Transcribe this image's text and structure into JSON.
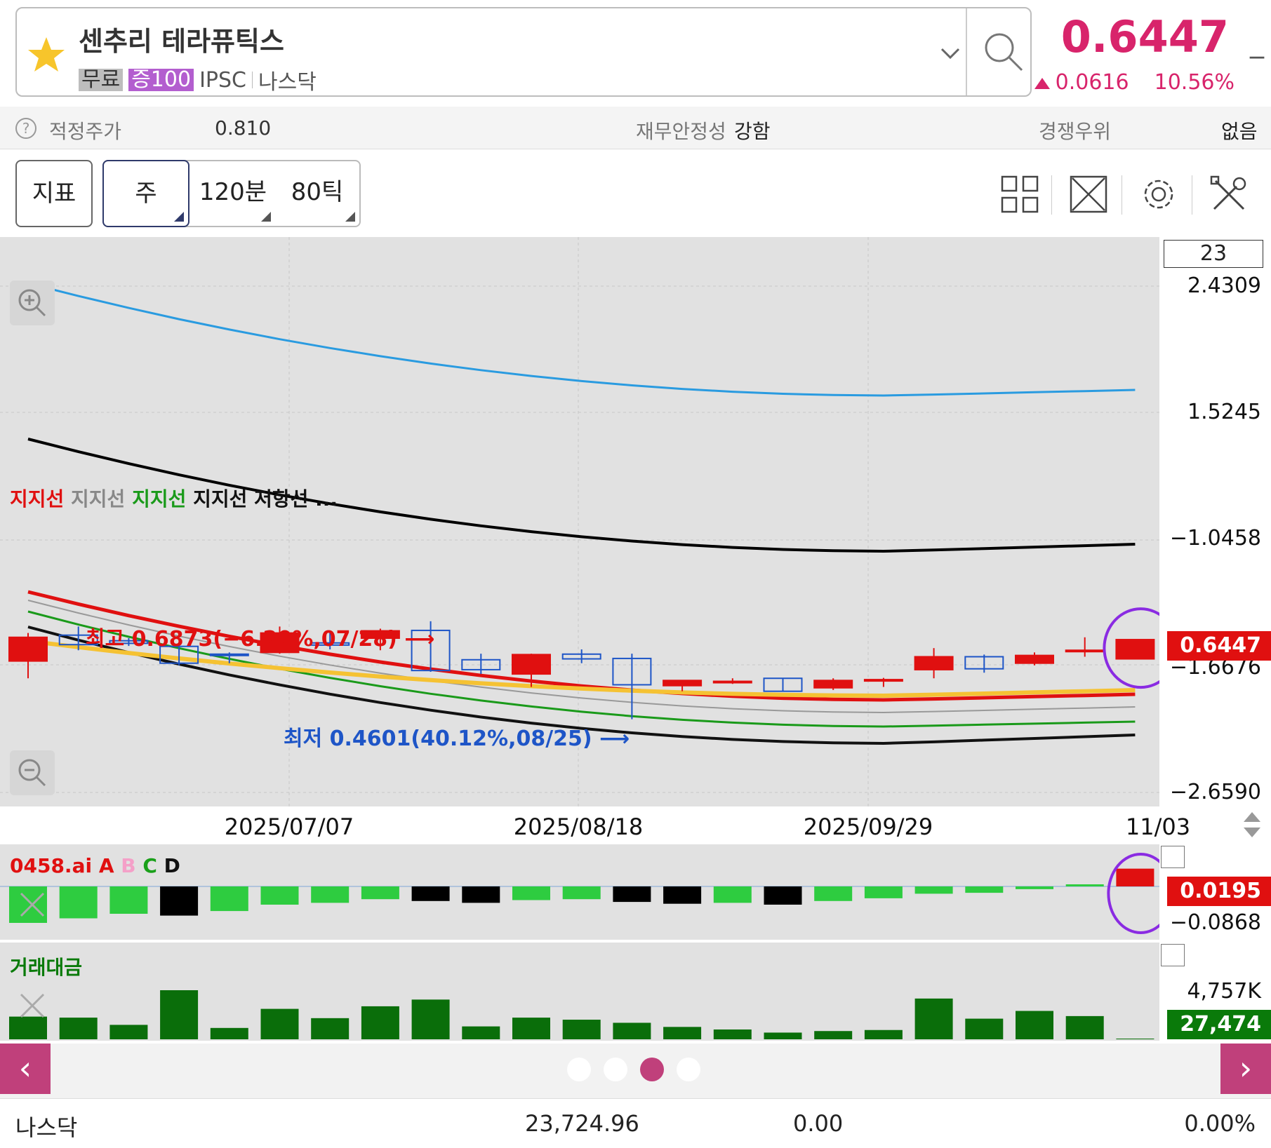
{
  "header": {
    "stock_name": "센추리 테라퓨틱스",
    "tags": {
      "free": "무료",
      "margin": "증100",
      "ticker": "IPSC",
      "exchange": "나스닥"
    },
    "price": "0.6447",
    "dash": "_",
    "change": "0.0616",
    "change_pct": "10.56%"
  },
  "fundamentals": {
    "fair_price_label": "적정주가",
    "fair_price_value": "0.810",
    "stability_label": "재무안정성",
    "stability_value": "강함",
    "competitive_label": "경쟁우위",
    "competitive_value": "없음"
  },
  "toolbar": {
    "indicator": "지표",
    "week": "주",
    "min120": "120분",
    "tick80": "80틱"
  },
  "main_chart": {
    "legend": [
      {
        "text": "지지선",
        "color": "#e01010"
      },
      {
        "text": "지지선",
        "color": "#888888"
      },
      {
        "text": "지지선",
        "color": "#1a9a1a"
      },
      {
        "text": "지지선",
        "color": "#111111"
      },
      {
        "text": "저항선 ...",
        "color": "#111111"
      }
    ],
    "zoom_box": "23",
    "y_labels": [
      "2.4309",
      "1.5245",
      "−1.0458",
      "−1.6676",
      "−2.6590"
    ],
    "price_pill": "0.6447",
    "high_annotation": "최고 0.6873(−6.20%,07/28)",
    "low_annotation": "최저 0.4601(40.12%,08/25)",
    "dates": [
      "2025/07/07",
      "2025/08/18",
      "2025/09/29",
      "11/03"
    ]
  },
  "ai_panel": {
    "title": "0458.ai",
    "letters": [
      {
        "text": "A",
        "color": "#e01010"
      },
      {
        "text": "B",
        "color": "#f4a0c8"
      },
      {
        "text": "C",
        "color": "#1aa01a"
      },
      {
        "text": "D",
        "color": "#111111"
      }
    ],
    "pill": "0.0195",
    "y_label": "−0.0868"
  },
  "volume_panel": {
    "title": "거래대금",
    "y_label": "4,757K",
    "pill": "27,474"
  },
  "chart_data": {
    "type": "candlestick",
    "candles": [
      {
        "o": 0.595,
        "h": 0.66,
        "l": 0.555,
        "c": 0.65,
        "up": true
      },
      {
        "o": 0.655,
        "h": 0.675,
        "l": 0.62,
        "c": 0.633,
        "up": false
      },
      {
        "o": 0.636,
        "h": 0.648,
        "l": 0.63,
        "c": 0.642,
        "up": false
      },
      {
        "o": 0.629,
        "h": 0.637,
        "l": 0.585,
        "c": 0.59,
        "up": false
      },
      {
        "o": 0.611,
        "h": 0.615,
        "l": 0.59,
        "c": 0.611,
        "up": false
      },
      {
        "o": 0.615,
        "h": 0.675,
        "l": 0.612,
        "c": 0.66,
        "up": true
      },
      {
        "o": 0.637,
        "h": 0.66,
        "l": 0.622,
        "c": 0.632,
        "up": false
      },
      {
        "o": 0.648,
        "h": 0.67,
        "l": 0.62,
        "c": 0.665,
        "up": true
      },
      {
        "o": 0.666,
        "h": 0.6873,
        "l": 0.57,
        "c": 0.573,
        "up": false
      },
      {
        "o": 0.598,
        "h": 0.612,
        "l": 0.565,
        "c": 0.575,
        "up": false
      },
      {
        "o": 0.565,
        "h": 0.612,
        "l": 0.535,
        "c": 0.61,
        "up": true
      },
      {
        "o": 0.611,
        "h": 0.622,
        "l": 0.59,
        "c": 0.6,
        "up": false
      },
      {
        "o": 0.601,
        "h": 0.612,
        "l": 0.4601,
        "c": 0.54,
        "up": false
      },
      {
        "o": 0.538,
        "h": 0.55,
        "l": 0.525,
        "c": 0.55,
        "up": true
      },
      {
        "o": 0.548,
        "h": 0.555,
        "l": 0.542,
        "c": 0.548,
        "up": true
      },
      {
        "o": 0.555,
        "h": 0.556,
        "l": 0.525,
        "c": 0.525,
        "up": false
      },
      {
        "o": 0.533,
        "h": 0.555,
        "l": 0.528,
        "c": 0.55,
        "up": true
      },
      {
        "o": 0.552,
        "h": 0.556,
        "l": 0.535,
        "c": 0.552,
        "up": true
      },
      {
        "o": 0.575,
        "h": 0.625,
        "l": 0.555,
        "c": 0.605,
        "up": true
      },
      {
        "o": 0.577,
        "h": 0.61,
        "l": 0.568,
        "c": 0.605,
        "up": false
      },
      {
        "o": 0.59,
        "h": 0.615,
        "l": 0.585,
        "c": 0.608,
        "up": true
      },
      {
        "o": 0.62,
        "h": 0.65,
        "l": 0.605,
        "c": 0.62,
        "up": true
      },
      {
        "o": 0.6,
        "h": 0.6447,
        "l": 0.6,
        "c": 0.6447,
        "up": true
      }
    ],
    "ai_bars": [
      -0.04,
      -0.035,
      -0.03,
      -0.032,
      -0.027,
      -0.02,
      -0.018,
      -0.014,
      -0.016,
      -0.018,
      -0.015,
      -0.014,
      -0.017,
      -0.019,
      -0.018,
      -0.02,
      -0.016,
      -0.013,
      -0.008,
      -0.007,
      -0.003,
      0.0,
      0.0195
    ],
    "ai_bar_colors": [
      "#2ecc40",
      "#2ecc40",
      "#2ecc40",
      "#000000",
      "#2ecc40",
      "#2ecc40",
      "#2ecc40",
      "#2ecc40",
      "#000000",
      "#000000",
      "#2ecc40",
      "#2ecc40",
      "#000000",
      "#000000",
      "#2ecc40",
      "#000000",
      "#2ecc40",
      "#2ecc40",
      "#2ecc40",
      "#2ecc40",
      "#2ecc40",
      "#2ecc40",
      "#e01010"
    ],
    "volume": [
      2200,
      2100,
      1400,
      4757,
      1100,
      2950,
      2050,
      3200,
      3850,
      1250,
      2100,
      1900,
      1600,
      1200,
      950,
      650,
      800,
      900,
      3950,
      2000,
      2750,
      2250,
      27
    ]
  },
  "pager": {
    "prev": "‹",
    "next": "›",
    "dots": 4,
    "active": 2
  },
  "footer": {
    "index_name": "나스닥",
    "index_value": "23,724.96",
    "index_change": "0.00",
    "index_pct": "0.00%"
  }
}
